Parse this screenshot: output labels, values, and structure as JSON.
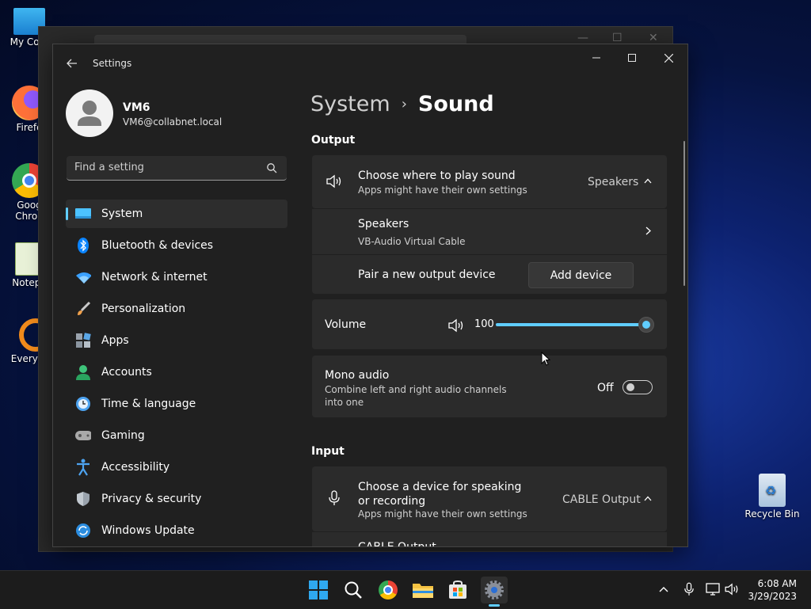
{
  "desktop": {
    "icons": [
      {
        "label": "My Com"
      },
      {
        "label": "Firefo"
      },
      {
        "label": "Goog Chron"
      },
      {
        "label": "Notepa"
      },
      {
        "label": "Everyth"
      },
      {
        "label": "Recycle Bin"
      }
    ]
  },
  "window": {
    "title": "Settings",
    "back_icon": "back-arrow-icon"
  },
  "profile": {
    "name": "VM6",
    "email": "VM6@collabnet.local"
  },
  "search": {
    "placeholder": "Find a setting"
  },
  "nav": [
    {
      "label": "System",
      "icon": "system-monitor-icon",
      "active": true
    },
    {
      "label": "Bluetooth & devices",
      "icon": "bluetooth-icon"
    },
    {
      "label": "Network & internet",
      "icon": "wifi-icon"
    },
    {
      "label": "Personalization",
      "icon": "brush-icon"
    },
    {
      "label": "Apps",
      "icon": "apps-icon"
    },
    {
      "label": "Accounts",
      "icon": "accounts-icon"
    },
    {
      "label": "Time & language",
      "icon": "time-language-icon"
    },
    {
      "label": "Gaming",
      "icon": "gamepad-icon"
    },
    {
      "label": "Accessibility",
      "icon": "accessibility-icon"
    },
    {
      "label": "Privacy & security",
      "icon": "shield-icon"
    },
    {
      "label": "Windows Update",
      "icon": "update-icon"
    }
  ],
  "breadcrumb": {
    "parent": "System",
    "separator": "›",
    "current": "Sound"
  },
  "output": {
    "section_title": "Output",
    "choose_title": "Choose where to play sound",
    "choose_sub": "Apps might have their own settings",
    "choose_value": "Speakers",
    "device_title": "Speakers",
    "device_sub": "VB-Audio Virtual Cable",
    "pair_label": "Pair a new output device",
    "add_device_label": "Add device",
    "volume_label": "Volume",
    "volume_value": "100",
    "volume_level": 1.0,
    "mono_title": "Mono audio",
    "mono_sub": "Combine left and right audio channels into one",
    "mono_state": "Off"
  },
  "input": {
    "section_title": "Input",
    "choose_title": "Choose a device for speaking or recording",
    "choose_sub": "Apps might have their own settings",
    "choose_value": "CABLE Output",
    "next_row_partial": "CABLE Output"
  },
  "taskbar": {
    "apps": [
      "start-icon",
      "search-icon",
      "chrome-icon",
      "file-explorer-icon",
      "store-icon",
      "settings-icon"
    ],
    "tray": [
      "chevron-up-icon",
      "microphone-icon",
      "network-icon",
      "volume-icon"
    ],
    "time": "6:08 AM",
    "date": "3/29/2023"
  },
  "colors": {
    "accent": "#60cdff",
    "window_bg": "#202020",
    "card_bg": "#2b2b2b"
  }
}
